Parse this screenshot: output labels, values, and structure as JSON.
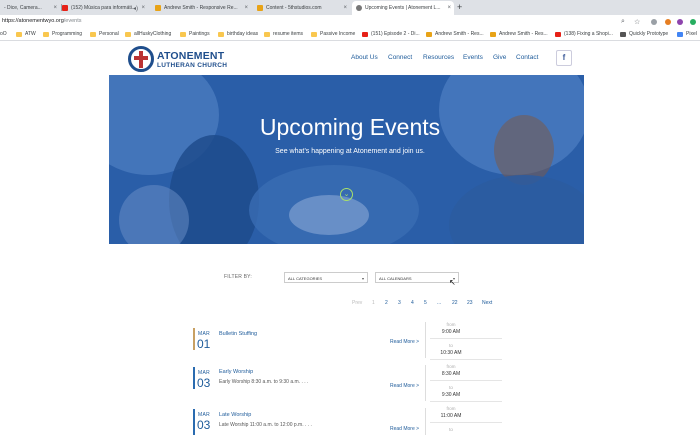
{
  "browser": {
    "tabs": [
      {
        "title": "- Dice, Camera...",
        "close": "×"
      },
      {
        "title": "(152) Música para informáti...",
        "close": "×"
      },
      {
        "title": "Andrew Smith - Responsive Re...",
        "close": "×"
      },
      {
        "title": "Content - 5thstudios.com",
        "close": "×"
      },
      {
        "title": "Upcoming Events | Atonement L...",
        "close": "×"
      }
    ],
    "new_tab": "+",
    "url_host": "https://atonementwyo.org",
    "url_path": "/events",
    "bookmarks": [
      {
        "label": "oO",
        "type": "none"
      },
      {
        "label": "ATW",
        "type": "folder"
      },
      {
        "label": "Programming",
        "type": "folder"
      },
      {
        "label": "Personal",
        "type": "folder"
      },
      {
        "label": "allHuskyClothing",
        "type": "folder"
      },
      {
        "label": "Paintings",
        "type": "folder"
      },
      {
        "label": "birthday ideas",
        "type": "folder"
      },
      {
        "label": "resume items",
        "type": "folder"
      },
      {
        "label": "Passive Income",
        "type": "folder"
      },
      {
        "label": "(151) Episode 2 - Di...",
        "type": "youtube"
      },
      {
        "label": "Andrew Smith - Res...",
        "type": "lion"
      },
      {
        "label": "Andrew Smith - Res...",
        "type": "lion"
      },
      {
        "label": "(138) Fixing a Shopi...",
        "type": "youtube"
      },
      {
        "label": "Quickly Prototype",
        "type": "none"
      },
      {
        "label": "Pixel",
        "type": "none"
      }
    ]
  },
  "site": {
    "logo_title": "ATONEMENT",
    "logo_sub": "LUTHERAN CHURCH",
    "nav": [
      "About Us",
      "Connect",
      "Resources",
      "Events",
      "Give",
      "Contact"
    ],
    "facebook": "f"
  },
  "hero": {
    "title": "Upcoming Events",
    "subtitle": "See what’s happening at Atonement and join us.",
    "arrow": "⌄"
  },
  "filters": {
    "label": "FILTER BY:",
    "categories": "ALL CATEGORIES",
    "calendars": "ALL CALENDARS",
    "caret": "▾"
  },
  "pagination": {
    "prev": "Prev",
    "pages": [
      "1",
      "2",
      "3",
      "4",
      "5",
      "...",
      "22",
      "23"
    ],
    "next": "Next"
  },
  "events": [
    {
      "month": "MAR",
      "day": "01",
      "title": "Bulletin Stuffing",
      "desc": "",
      "more": "Read More >",
      "from_label": "from",
      "start": "9:00 AM",
      "to_label": "to",
      "end": "10:30 AM",
      "bar_color": "#c8a063"
    },
    {
      "month": "MAR",
      "day": "03",
      "title": "Early Worship",
      "desc": "Early Worship 8:30 a.m. to 9:30 a.m. . . .",
      "more": "Read More >",
      "from_label": "from",
      "start": "8:30 AM",
      "to_label": "to",
      "end": "9:30 AM",
      "bar_color": "#2a6bb0"
    },
    {
      "month": "MAR",
      "day": "03",
      "title": "Late Worship",
      "desc": "Late Worship 11:00 a.m. to 12:00 p.m. . . .",
      "more": "Read More >",
      "from_label": "from",
      "start": "11:00 AM",
      "to_label": "to",
      "end": "",
      "bar_color": "#2a6bb0"
    }
  ]
}
